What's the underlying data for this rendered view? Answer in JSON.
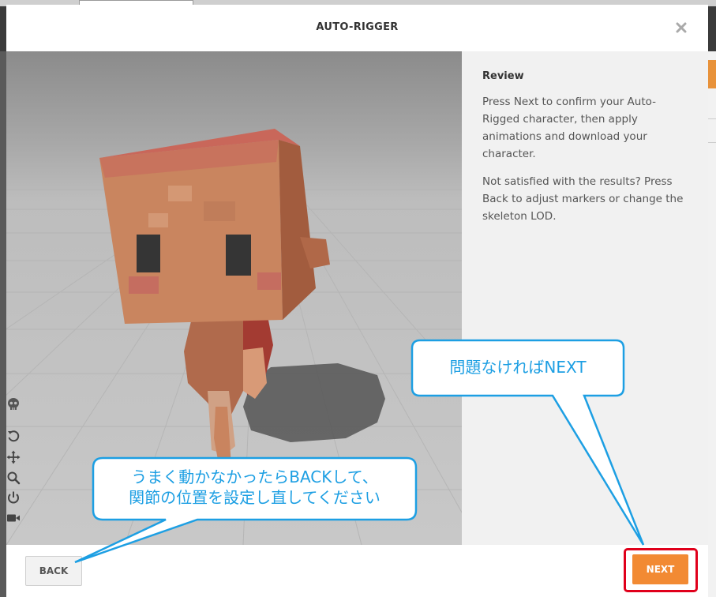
{
  "modal": {
    "title": "AUTO-RIGGER",
    "close_icon": "close-icon"
  },
  "toolbar": {
    "icons": [
      "skull-icon",
      "rotate-icon",
      "move-icon",
      "zoom-icon",
      "power-icon",
      "camera-icon"
    ]
  },
  "info": {
    "heading": "Review",
    "paragraph1": "Press Next to confirm your Auto-Rigged character, then apply animations and download your character.",
    "paragraph2": "Not satisfied with the results? Press Back to adjust markers or change the skeleton LOD."
  },
  "footer": {
    "back_label": "BACK",
    "next_label": "NEXT"
  },
  "annotations": {
    "next_note": "問題なければNEXT",
    "back_note_line1": "うまく動かなかったらBACKして、",
    "back_note_line2": "関節の位置を設定し直してください"
  },
  "colors": {
    "accent": "#f28a33",
    "highlight": "#e0001b",
    "callout": "#1d9fe3"
  }
}
